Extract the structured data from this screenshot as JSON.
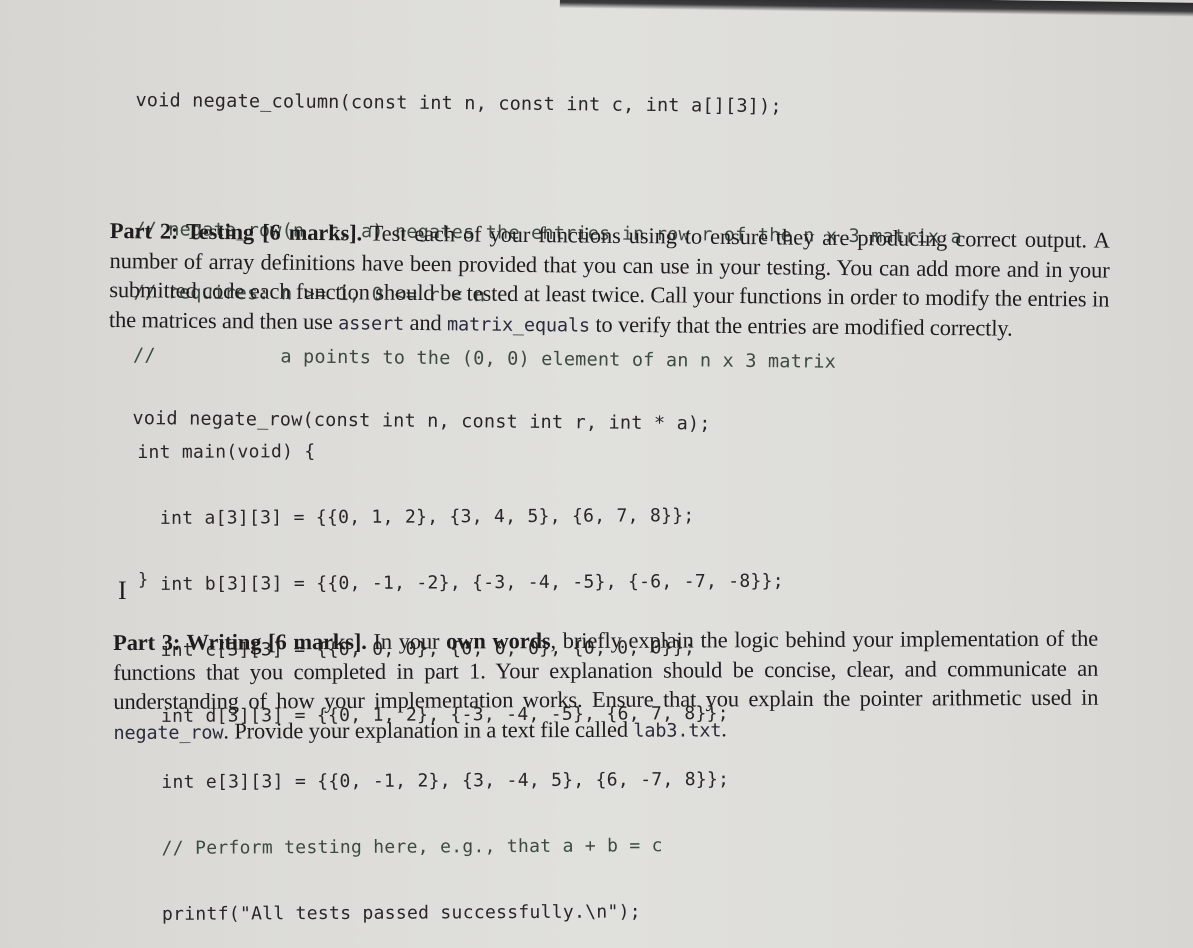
{
  "document": {
    "top_code": [
      {
        "text": "void negate_column(const int n, const int c, int a[][3]);",
        "type": "code"
      },
      {
        "text": "",
        "type": "gap"
      },
      {
        "text": "// negate_row(n, r, a) negates the entries in row r of the n x 3 matrix a",
        "type": "comment"
      },
      {
        "text": "// requires: n >= 1, 0 <= r < n",
        "type": "comment"
      },
      {
        "text": "//           a points to the (0, 0) element of an n x 3 matrix",
        "type": "comment"
      },
      {
        "text": "void negate_row(const int n, const int r, int * a);",
        "type": "code"
      }
    ],
    "part2": {
      "heading": "Part 2: Testing [6 marks].",
      "text_before_assert": " Test each of your functions using to ensure they are producing correct output. A number of array definitions have been provided that you can use in your testing. You can add more and in your submitted code each function should be tested at least twice. Call your functions in order to modify the entries in the matrices and then use ",
      "assert_code": "assert",
      "text_and": " and ",
      "matrix_equals_code": "matrix_equals",
      "text_after": " to verify that the entries are modified correctly."
    },
    "main_code": [
      {
        "text": "int main(void) {",
        "type": "code"
      },
      {
        "text": "  int a[3][3] = {{0, 1, 2}, {3, 4, 5}, {6, 7, 8}};",
        "type": "code"
      },
      {
        "text": "  int b[3][3] = {{0, -1, -2}, {-3, -4, -5}, {-6, -7, -8}};",
        "type": "code"
      },
      {
        "text": "  int c[3][3] = {{0, 0, 0}, {0, 0, 0}, {0, 0, 0}};",
        "type": "code"
      },
      {
        "text": "  int d[3][3] = {{0, 1, 2}, {-3, -4, -5}, {6, 7, 8}};",
        "type": "code"
      },
      {
        "text": "  int e[3][3] = {{0, -1, 2}, {3, -4, 5}, {6, -7, 8}};",
        "type": "code"
      },
      {
        "text": "  // Perform testing here, e.g., that a + b = c",
        "type": "comment"
      },
      {
        "text": "  printf(\"All tests passed successfully.\\n\");",
        "type": "code"
      }
    ],
    "closing_brace": "}",
    "cursor_glyph": "I",
    "part3": {
      "heading": "Part 3: Writing [6 marks].",
      "text_1": " In your ",
      "emphasis": "own words",
      "text_2": ", briefly explain the logic behind your implementation of the functions that you completed in part 1. Your explanation should be concise, clear, and communicate an understanding of how your implementation works. Ensure that you explain the pointer arithmetic used in ",
      "negate_row_code": "negate_row",
      "text_3": ". Provide your explanation in a text file called ",
      "filename_code": "lab3.txt",
      "text_4": "."
    }
  }
}
